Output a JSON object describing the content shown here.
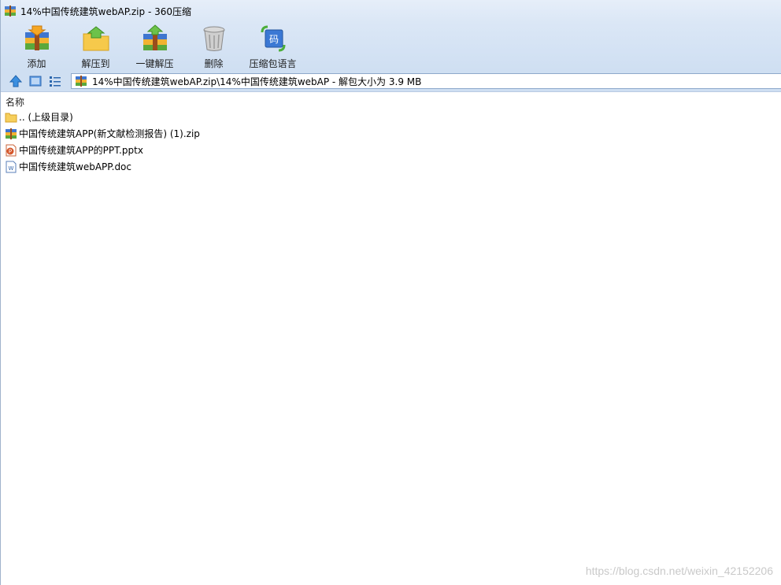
{
  "window": {
    "title": "14%中国传统建筑webAP.zip - 360压缩"
  },
  "toolbar": {
    "buttons": [
      {
        "label": "添加",
        "icon": "add-archive-icon"
      },
      {
        "label": "解压到",
        "icon": "extract-to-folder-icon"
      },
      {
        "label": "一键解压",
        "icon": "one-click-extract-icon"
      },
      {
        "label": "删除",
        "icon": "trash-icon"
      },
      {
        "label": "压缩包语言",
        "icon": "archive-language-icon"
      }
    ]
  },
  "navigation": {
    "icons": [
      "up-arrow-icon",
      "view-mode-icon",
      "list-view-icon"
    ],
    "address_path": "14%中国传统建筑webAP.zip\\14%中国传统建筑webAP - 解包大小为 3.9 MB"
  },
  "file_list": {
    "column_header": "名称",
    "rows": [
      {
        "name": ".. (上级目录)",
        "icon": "folder-icon"
      },
      {
        "name": "中国传统建筑APP(新文献检测报告) (1).zip",
        "icon": "zip-archive-icon"
      },
      {
        "name": "中国传统建筑APP的PPT.pptx",
        "icon": "powerpoint-file-icon"
      },
      {
        "name": "中国传统建筑webAPP.doc",
        "icon": "word-file-icon"
      }
    ]
  },
  "watermark": "https://blog.csdn.net/weixin_42152206",
  "colors": {
    "toolbar_bg": "#dbe7f6",
    "accent_blue": "#2f6fc7"
  }
}
